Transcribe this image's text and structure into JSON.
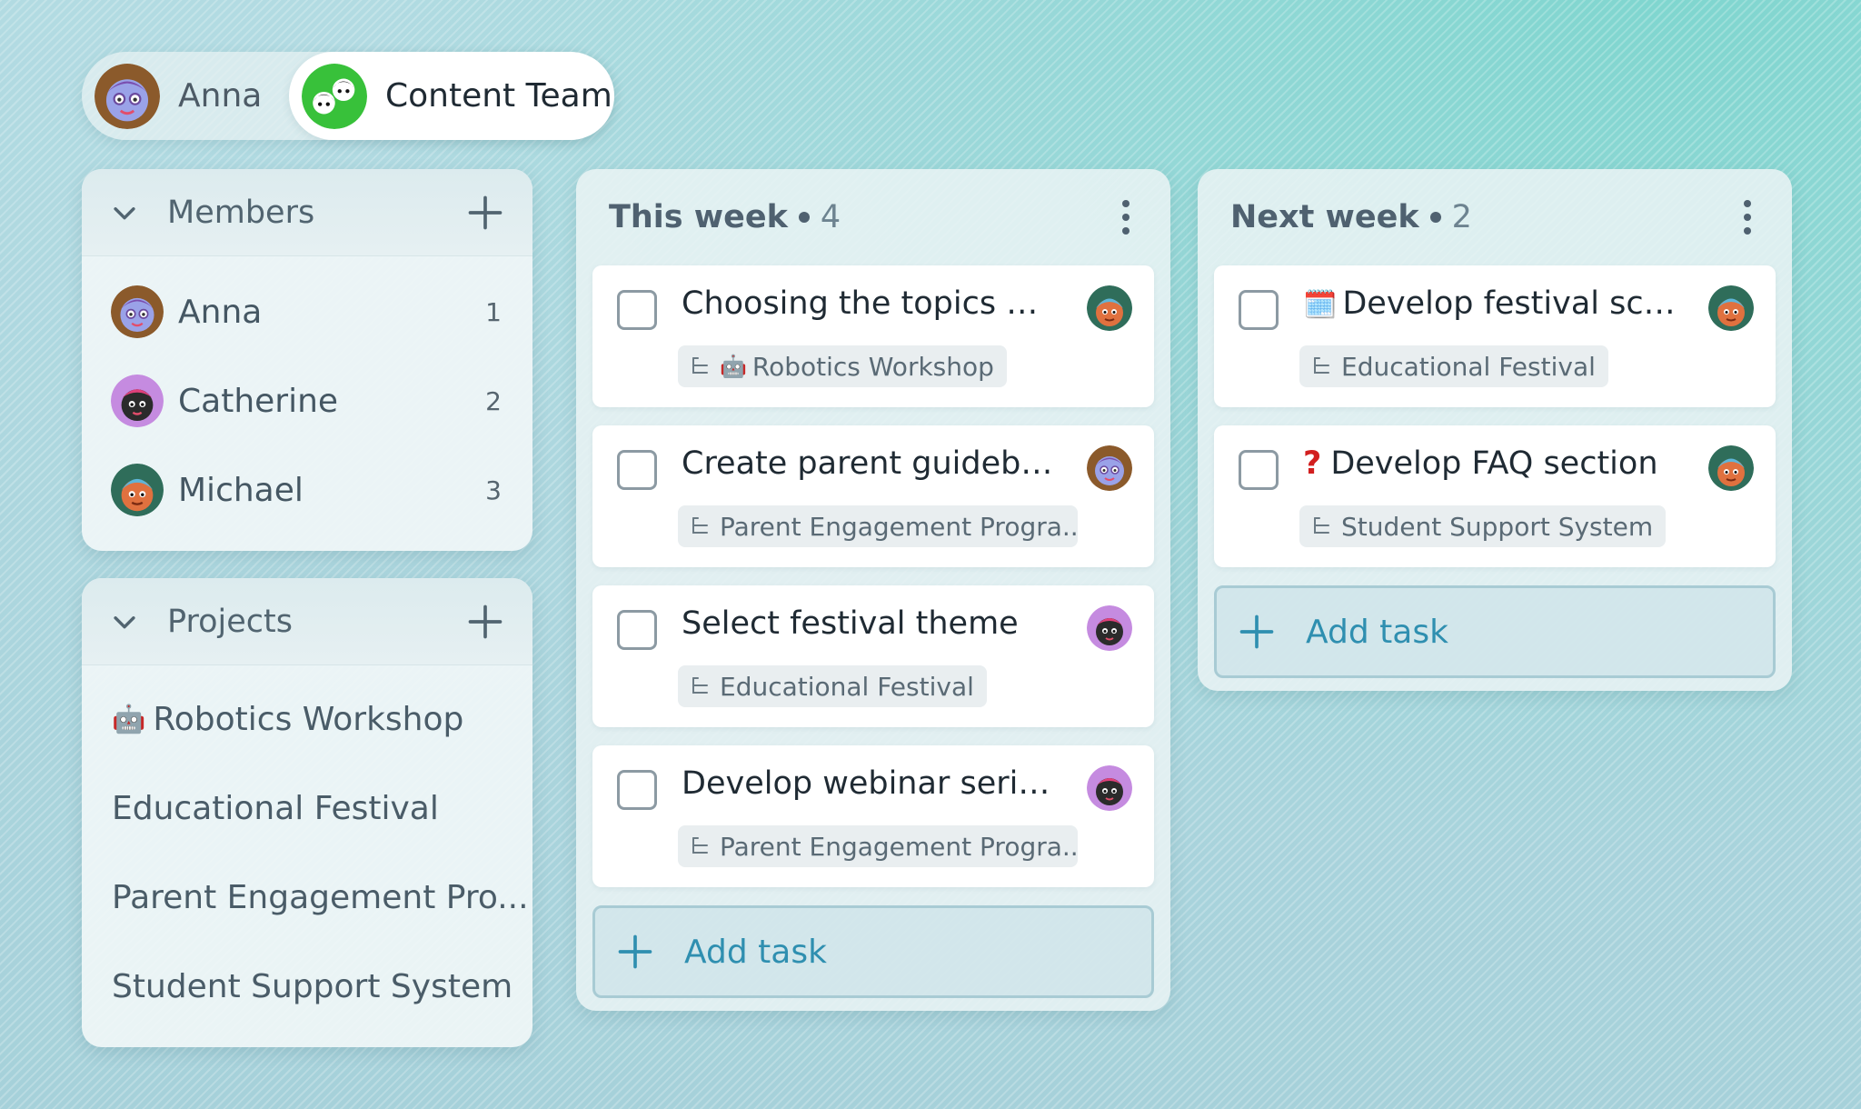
{
  "switcher": {
    "user_label": "Anna",
    "team_label": "Content Team"
  },
  "members": {
    "title": "Members",
    "items": [
      {
        "name": "Anna",
        "count": "1"
      },
      {
        "name": "Catherine",
        "count": "2"
      },
      {
        "name": "Michael",
        "count": "3"
      }
    ]
  },
  "projects": {
    "title": "Projects",
    "items": [
      {
        "emoji": "🤖",
        "name": "Robotics Workshop"
      },
      {
        "emoji": "",
        "name": "Educational Festival"
      },
      {
        "emoji": "",
        "name": "Parent Engagement Pro..."
      },
      {
        "emoji": "",
        "name": "Student Support System"
      }
    ]
  },
  "columns": {
    "this_week": {
      "title": "This week",
      "count": "4",
      "add_label": "Add task",
      "tasks": [
        {
          "title": "Choosing the topics an...",
          "project": "Robotics Workshop",
          "project_emoji": "🤖",
          "assignee": "Michael"
        },
        {
          "title": "Create parent guidebook",
          "project": "Parent Engagement Progra...",
          "assignee": "Anna"
        },
        {
          "title": "Select festival theme",
          "project": "Educational Festival",
          "assignee": "Catherine"
        },
        {
          "title": "Develop webinar series",
          "project": "Parent Engagement Progra...",
          "assignee": "Catherine"
        }
      ]
    },
    "next_week": {
      "title": "Next week",
      "count": "2",
      "add_label": "Add task",
      "tasks": [
        {
          "title": "Develop festival sche...",
          "title_emoji": "🗓️",
          "project": "Educational Festival",
          "assignee": "Michael"
        },
        {
          "title": "Develop FAQ section",
          "title_emoji": "❓",
          "project": "Student Support System",
          "assignee": "Michael"
        }
      ]
    }
  },
  "icons": {
    "collapse": "chevron-down-icon",
    "add": "plus-icon",
    "menu": "kebab-menu-icon",
    "subtask": "subtask-icon"
  },
  "colors": {
    "accent": "#2f8fb0",
    "avatar_anna_bg": "#8b5a2b",
    "avatar_catherine_bg": "#c58be0",
    "avatar_michael_bg": "#2f6d5a",
    "avatar_team_bg": "#38c13a"
  }
}
